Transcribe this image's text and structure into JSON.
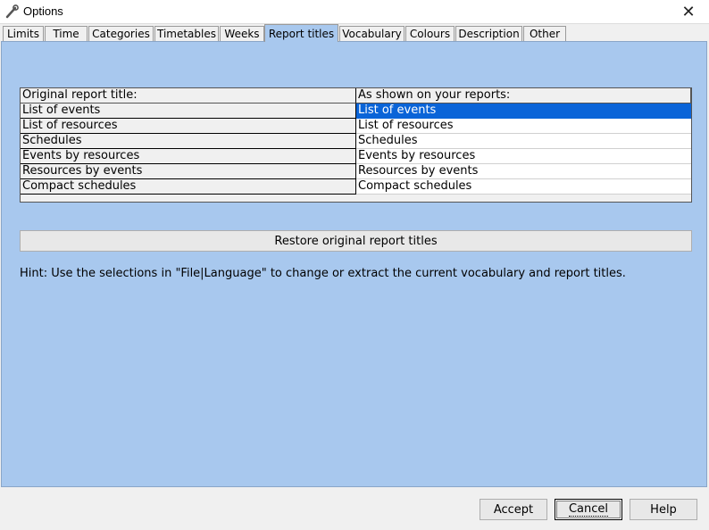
{
  "window": {
    "title": "Options",
    "close_glyph": "✕"
  },
  "tabs": [
    {
      "label": "Limits"
    },
    {
      "label": "Time"
    },
    {
      "label": "Categories"
    },
    {
      "label": "Timetables"
    },
    {
      "label": "Weeks"
    },
    {
      "label": "Report titles",
      "active": true
    },
    {
      "label": "Vocabulary"
    },
    {
      "label": "Colours"
    },
    {
      "label": "Description"
    },
    {
      "label": "Other"
    }
  ],
  "grid": {
    "header_left": "Original report title:",
    "header_right": "As shown on your reports:",
    "rows": [
      {
        "original": "List of events",
        "shown": "List of events",
        "selected": true
      },
      {
        "original": "List of resources",
        "shown": "List of resources"
      },
      {
        "original": "Schedules",
        "shown": "Schedules"
      },
      {
        "original": "Events by resources",
        "shown": "Events by resources"
      },
      {
        "original": "Resources by events",
        "shown": "Resources by events"
      },
      {
        "original": "Compact schedules",
        "shown": "Compact schedules"
      }
    ]
  },
  "restore_button": "Restore original report titles",
  "hint": "Hint: Use the selections in \"File|Language\" to change or extract the current vocabulary and report titles.",
  "buttons": {
    "accept": "Accept",
    "cancel": "Cancel",
    "help": "Help"
  },
  "colors": {
    "panel": "#a8c8ee",
    "selection": "#0a64d8"
  },
  "icons": {
    "app": "wrench-icon",
    "close": "close-icon"
  }
}
